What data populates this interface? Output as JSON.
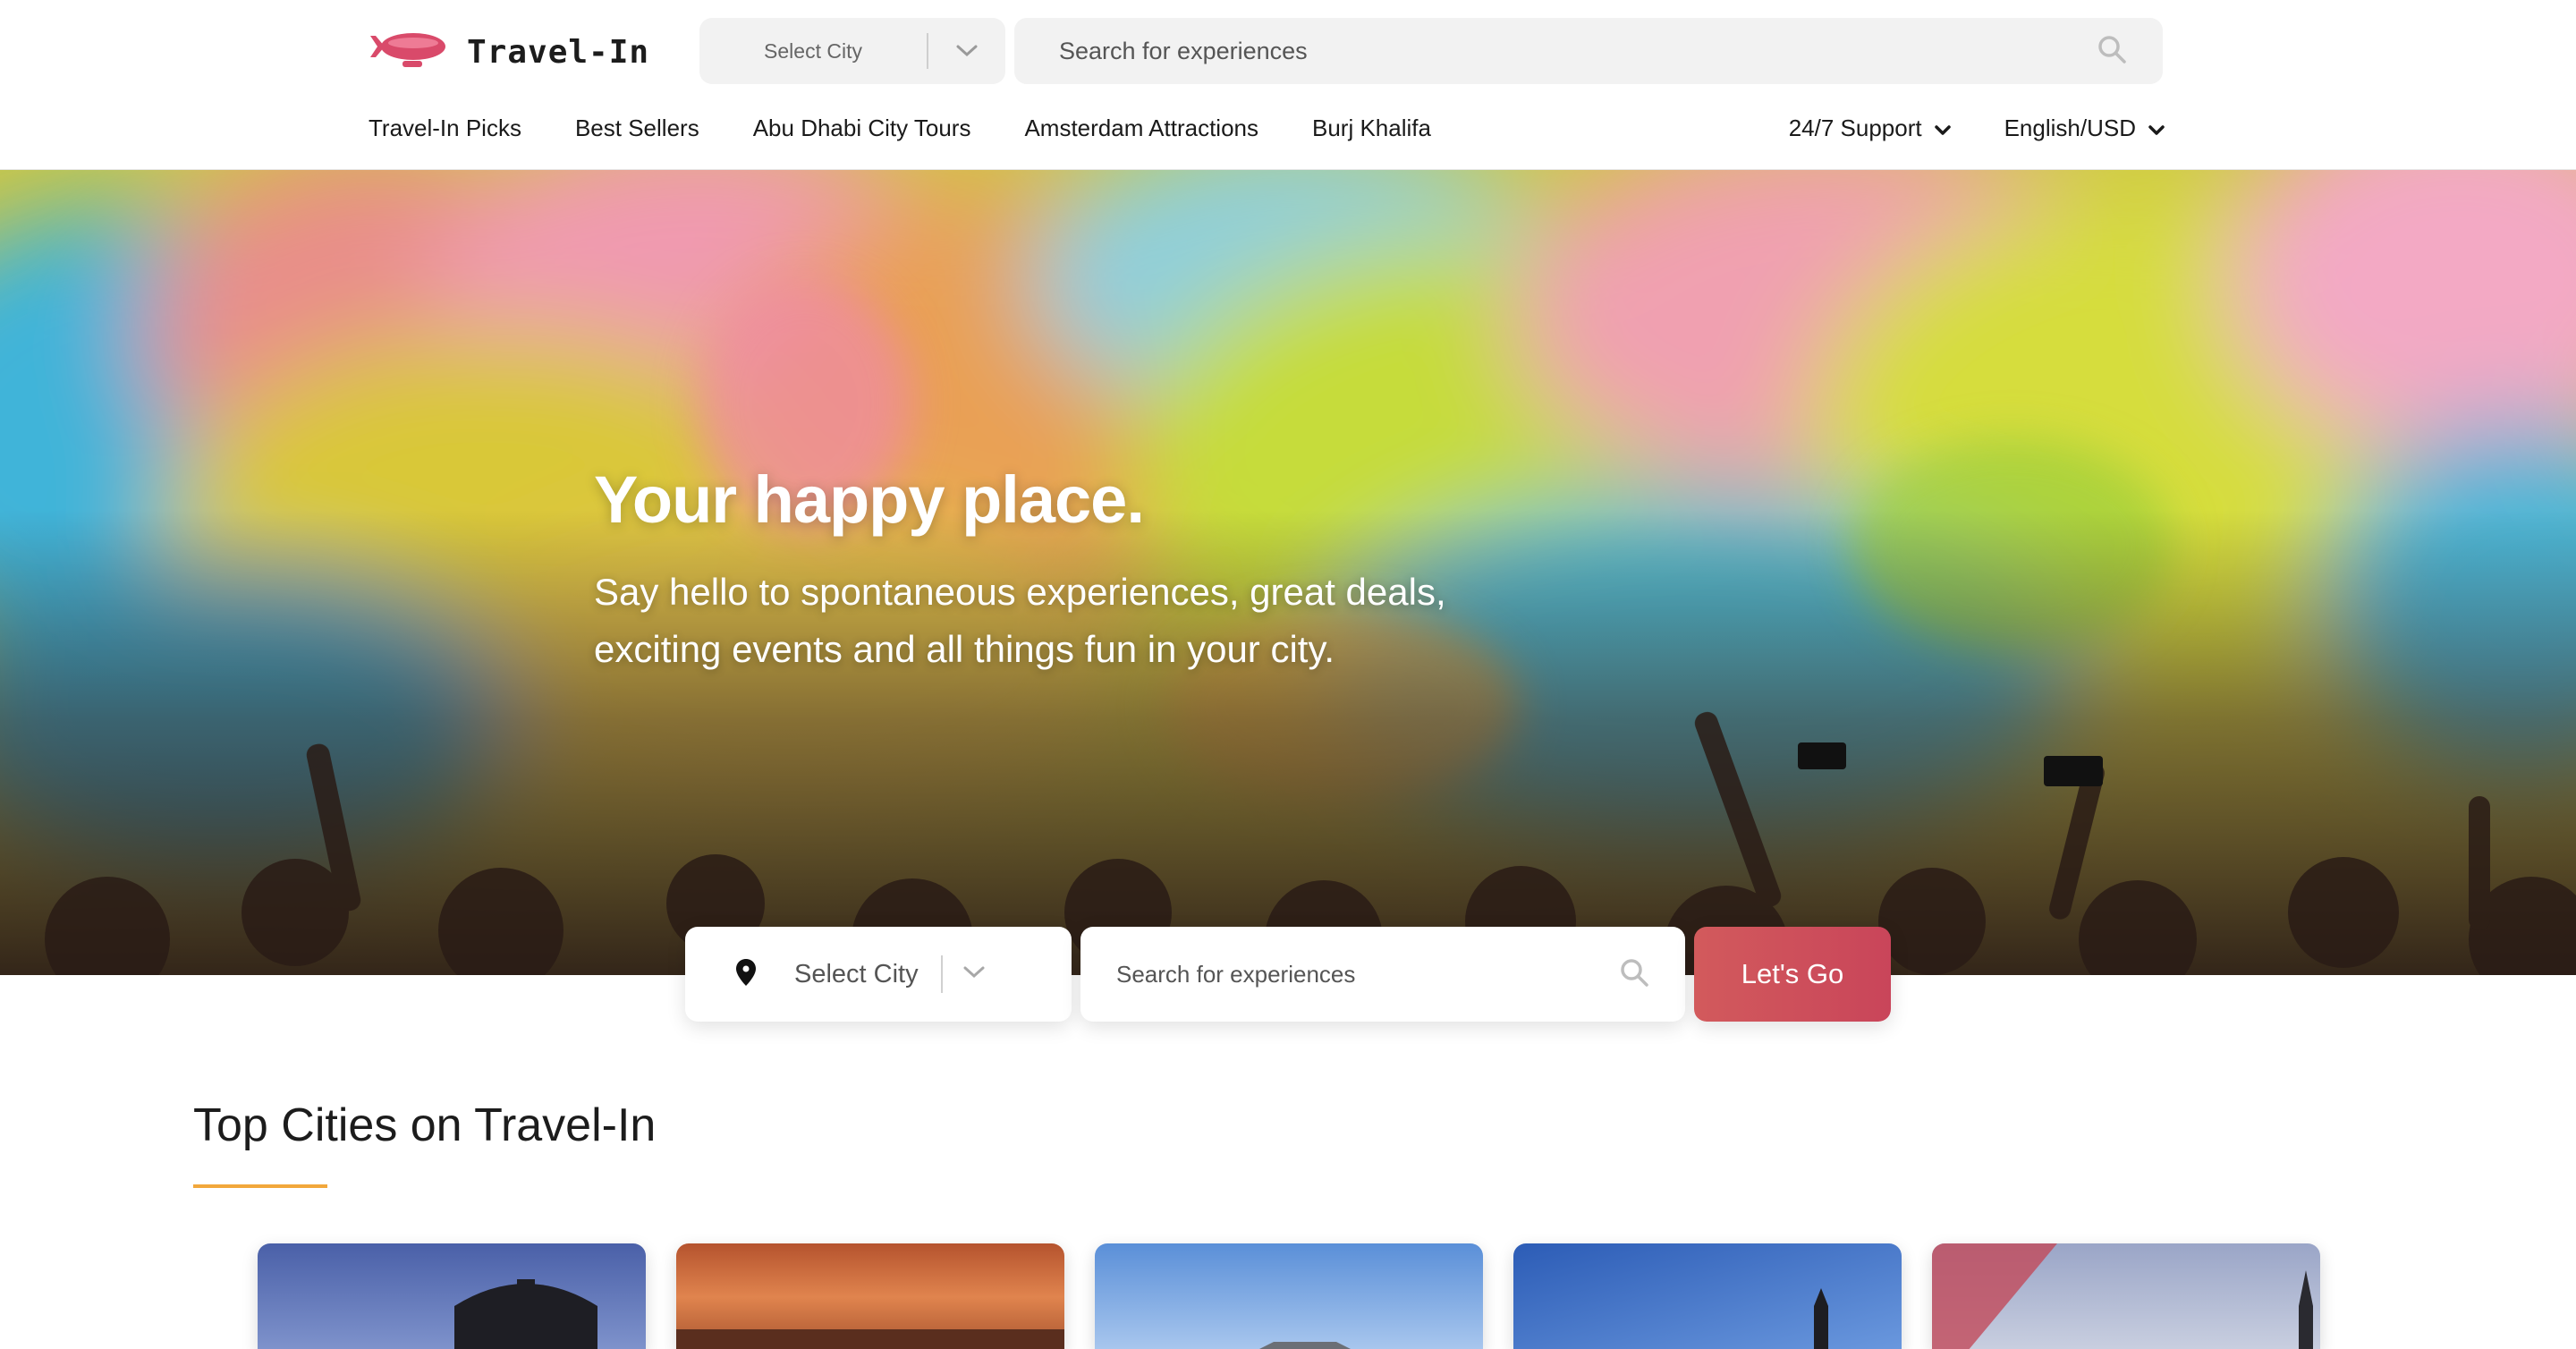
{
  "header": {
    "brand": "Travel-In",
    "city_select": {
      "label": "Select City"
    },
    "search": {
      "placeholder": "Search for experiences"
    },
    "nav": [
      {
        "label": "Travel-In Picks"
      },
      {
        "label": "Best Sellers"
      },
      {
        "label": "Abu Dhabi City Tours"
      },
      {
        "label": "Amsterdam Attractions"
      },
      {
        "label": "Burj Khalifa"
      }
    ],
    "support": "24/7 Support",
    "locale": "English/USD"
  },
  "hero": {
    "title": "Your happy place.",
    "subtitle": "Say hello to spontaneous experiences, great deals, exciting events and all things fun in your city.",
    "city_select": {
      "label": "Select City"
    },
    "search": {
      "placeholder": "Search for experiences"
    },
    "cta": "Let's Go"
  },
  "top_cities": {
    "title": "Top Cities on Travel-In"
  },
  "colors": {
    "accent": "#cf4f5b",
    "underline": "#f2a73b",
    "field_bg": "#f2f2f2"
  },
  "icons": [
    "airship-logo-icon",
    "chevron-down-icon",
    "search-icon",
    "location-pin-icon",
    "caret-down-icon"
  ]
}
